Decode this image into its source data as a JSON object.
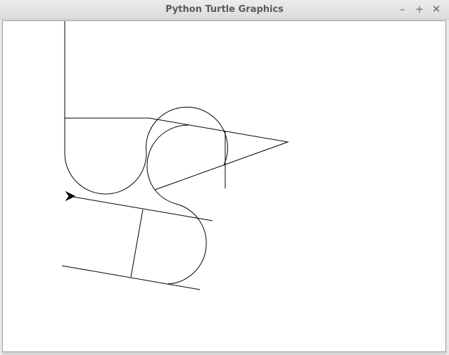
{
  "window": {
    "title": "Python Turtle Graphics",
    "controls": {
      "minimize": "–",
      "maximize": "+",
      "close": "✕"
    }
  },
  "canvas": {
    "background": "#ffffff",
    "stroke": "#000000"
  },
  "turtle": {
    "icon": "turtle-arrow-icon",
    "heading": "east"
  }
}
